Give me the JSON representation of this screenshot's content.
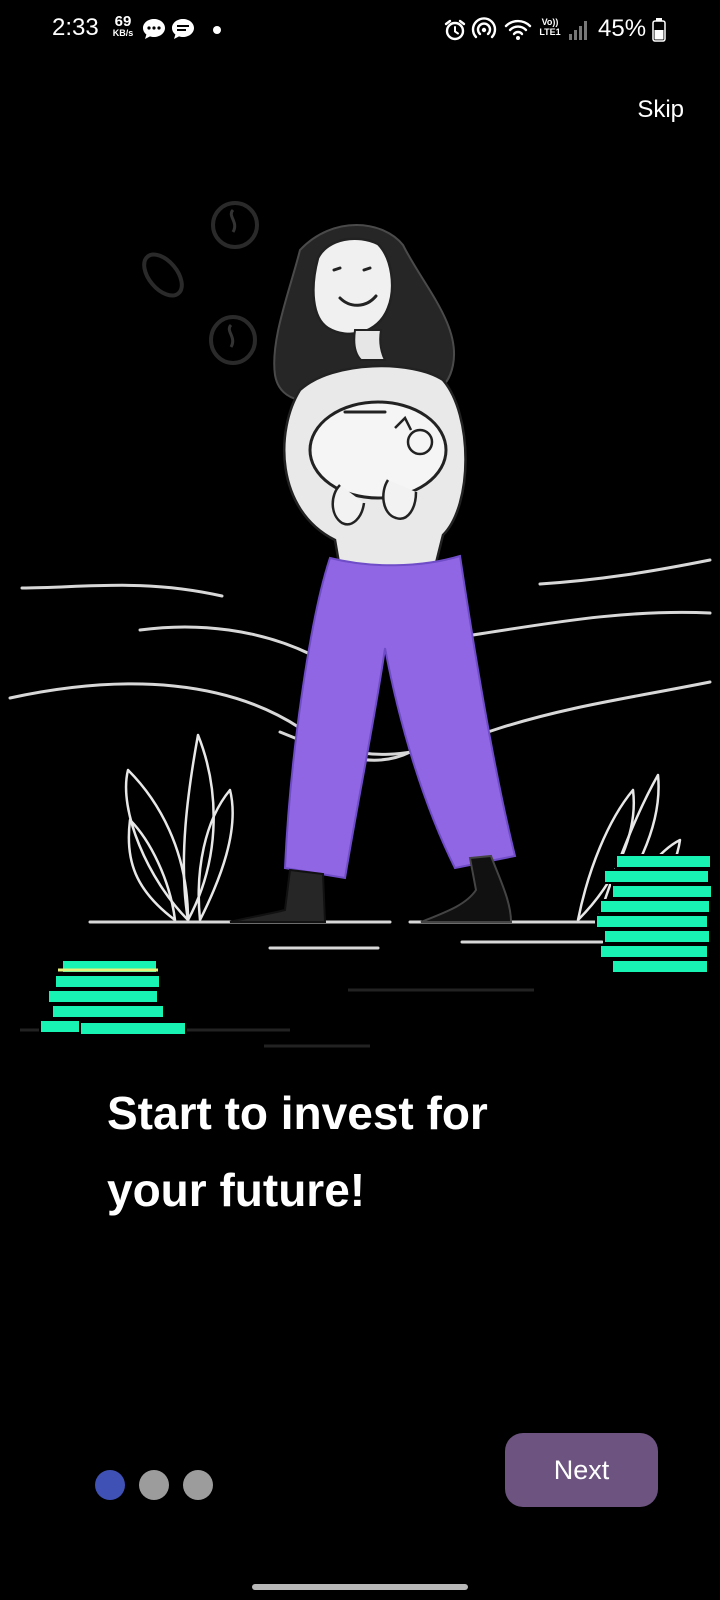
{
  "status_bar": {
    "time": "2:33",
    "speed_value": "69",
    "speed_unit": "KB/s",
    "network_label_top": "Vo))",
    "network_label_bottom": "LTE1",
    "battery": "45%"
  },
  "onboarding": {
    "skip_label": "Skip",
    "headline_line1": "Start to invest for",
    "headline_line2": "your future!",
    "next_label": "Next",
    "page_count": 3,
    "active_page": 1
  },
  "colors": {
    "background": "#000000",
    "pants": "#9166e4",
    "coins": "#18f2b2",
    "next_button": "#6c5380",
    "active_dot": "#3f51b5",
    "inactive_dot": "#9c9c9c"
  }
}
